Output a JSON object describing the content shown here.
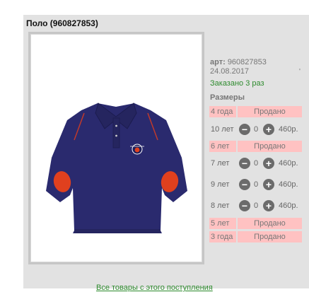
{
  "product": {
    "title": "Поло (960827853)",
    "article_label": "арт:",
    "article_value": "960827853",
    "date": "24.08.2017",
    "tick": "'",
    "ordered": "Заказано 3 раз",
    "sizes_title": "Размеры"
  },
  "sizes": [
    {
      "size": "4 года",
      "status": "Продано"
    },
    {
      "size": "10 лет",
      "qty": "0",
      "price": "460р."
    },
    {
      "size": "6 лет",
      "status": "Продано"
    },
    {
      "size": "7 лет",
      "qty": "0",
      "price": "460р."
    },
    {
      "size": "9 лет",
      "qty": "0",
      "price": "460р."
    },
    {
      "size": "8 лет",
      "qty": "0",
      "price": "460р."
    },
    {
      "size": "5 лет",
      "status": "Продано"
    },
    {
      "size": "3 года",
      "status": "Продано"
    }
  ],
  "stepper": {
    "minus_icon": "minus-circle-icon",
    "plus_icon": "plus-circle-icon"
  },
  "footer": {
    "link_text": "Все товары с этого поступления"
  },
  "colors": {
    "sold_bg": "#ffc2c2",
    "ordered_text": "#2e8b2e",
    "shirt": "#2a2a6e",
    "patch": "#e0401e"
  }
}
